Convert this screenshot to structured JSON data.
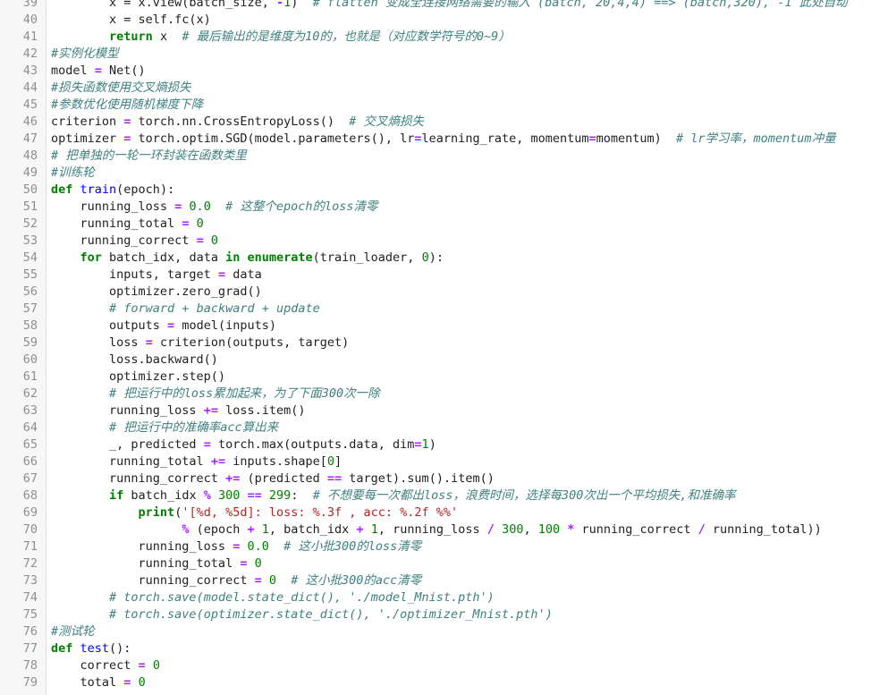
{
  "editor": {
    "language": "python",
    "colors": {
      "keyword": "#008000",
      "function_name": "#0000ff",
      "number": "#008000",
      "operator": "#aa22ff",
      "string": "#ba2121",
      "comment": "#408080",
      "line_number": "#8f8f8f",
      "text": "#1f1f1f"
    },
    "lines": [
      {
        "n": "39",
        "t": [
          [
            "tx",
            "        x = x.view(batch_size, "
          ],
          [
            "op",
            "-"
          ],
          [
            "num",
            "1"
          ],
          [
            "tx",
            ")  "
          ],
          [
            "cm",
            "# flatten 变成全连接网络需要的输入 (batch, 20,4,4) ==> (batch,320), -1 此处自动"
          ]
        ]
      },
      {
        "n": "40",
        "t": [
          [
            "tx",
            "        x = self.fc(x)"
          ]
        ]
      },
      {
        "n": "41",
        "t": [
          [
            "tx",
            "        "
          ],
          [
            "kw",
            "return"
          ],
          [
            "tx",
            " x  "
          ],
          [
            "cm",
            "# 最后输出的是维度为10的，也就是（对应数学符号的0~9）"
          ]
        ]
      },
      {
        "n": "42",
        "t": [
          [
            "cm",
            "#实例化模型"
          ]
        ]
      },
      {
        "n": "43",
        "t": [
          [
            "tx",
            "model "
          ],
          [
            "op",
            "="
          ],
          [
            "tx",
            " Net()"
          ]
        ]
      },
      {
        "n": "44",
        "t": [
          [
            "cm",
            "#损失函数使用交叉熵损失"
          ]
        ]
      },
      {
        "n": "45",
        "t": [
          [
            "cm",
            "#参数优化使用随机梯度下降"
          ]
        ]
      },
      {
        "n": "46",
        "t": [
          [
            "tx",
            "criterion "
          ],
          [
            "op",
            "="
          ],
          [
            "tx",
            " torch.nn.CrossEntropyLoss()  "
          ],
          [
            "cm",
            "# 交叉熵损失"
          ]
        ]
      },
      {
        "n": "47",
        "t": [
          [
            "tx",
            "optimizer "
          ],
          [
            "op",
            "="
          ],
          [
            "tx",
            " torch.optim.SGD(model.parameters(), lr"
          ],
          [
            "op",
            "="
          ],
          [
            "tx",
            "learning_rate, momentum"
          ],
          [
            "op",
            "="
          ],
          [
            "tx",
            "momentum)  "
          ],
          [
            "cm",
            "# lr学习率，momentum冲量"
          ]
        ]
      },
      {
        "n": "48",
        "t": [
          [
            "cm",
            "# 把单独的一轮一环封装在函数类里"
          ]
        ]
      },
      {
        "n": "49",
        "t": [
          [
            "cm",
            "#训练轮"
          ]
        ]
      },
      {
        "n": "50",
        "t": [
          [
            "kw",
            "def"
          ],
          [
            "tx",
            " "
          ],
          [
            "fn",
            "train"
          ],
          [
            "tx",
            "(epoch):"
          ]
        ]
      },
      {
        "n": "51",
        "t": [
          [
            "tx",
            "    running_loss "
          ],
          [
            "op",
            "="
          ],
          [
            "tx",
            " "
          ],
          [
            "num",
            "0.0"
          ],
          [
            "tx",
            "  "
          ],
          [
            "cm",
            "# 这整个epoch的loss清零"
          ]
        ]
      },
      {
        "n": "52",
        "t": [
          [
            "tx",
            "    running_total "
          ],
          [
            "op",
            "="
          ],
          [
            "tx",
            " "
          ],
          [
            "num",
            "0"
          ]
        ]
      },
      {
        "n": "53",
        "t": [
          [
            "tx",
            "    running_correct "
          ],
          [
            "op",
            "="
          ],
          [
            "tx",
            " "
          ],
          [
            "num",
            "0"
          ]
        ]
      },
      {
        "n": "54",
        "t": [
          [
            "tx",
            "    "
          ],
          [
            "kw",
            "for"
          ],
          [
            "tx",
            " batch_idx, data "
          ],
          [
            "kw",
            "in"
          ],
          [
            "tx",
            " "
          ],
          [
            "kw",
            "enumerate"
          ],
          [
            "tx",
            "(train_loader, "
          ],
          [
            "num",
            "0"
          ],
          [
            "tx",
            "):"
          ]
        ]
      },
      {
        "n": "55",
        "t": [
          [
            "tx",
            "        inputs, target "
          ],
          [
            "op",
            "="
          ],
          [
            "tx",
            " data"
          ]
        ]
      },
      {
        "n": "56",
        "t": [
          [
            "tx",
            "        optimizer.zero_grad()"
          ]
        ]
      },
      {
        "n": "57",
        "t": [
          [
            "tx",
            "        "
          ],
          [
            "cm",
            "# forward + backward + update"
          ]
        ]
      },
      {
        "n": "58",
        "t": [
          [
            "tx",
            "        outputs "
          ],
          [
            "op",
            "="
          ],
          [
            "tx",
            " model(inputs)"
          ]
        ]
      },
      {
        "n": "59",
        "t": [
          [
            "tx",
            "        loss "
          ],
          [
            "op",
            "="
          ],
          [
            "tx",
            " criterion(outputs, target)"
          ]
        ]
      },
      {
        "n": "60",
        "t": [
          [
            "tx",
            "        loss.backward()"
          ]
        ]
      },
      {
        "n": "61",
        "t": [
          [
            "tx",
            "        optimizer.step()"
          ]
        ]
      },
      {
        "n": "62",
        "t": [
          [
            "tx",
            "        "
          ],
          [
            "cm",
            "# 把运行中的loss累加起来，为了下面300次一除"
          ]
        ]
      },
      {
        "n": "63",
        "t": [
          [
            "tx",
            "        running_loss "
          ],
          [
            "op",
            "+="
          ],
          [
            "tx",
            " loss.item()"
          ]
        ]
      },
      {
        "n": "64",
        "t": [
          [
            "tx",
            "        "
          ],
          [
            "cm",
            "# 把运行中的准确率acc算出来"
          ]
        ]
      },
      {
        "n": "65",
        "t": [
          [
            "tx",
            "        _, predicted "
          ],
          [
            "op",
            "="
          ],
          [
            "tx",
            " torch.max(outputs.data, dim"
          ],
          [
            "op",
            "="
          ],
          [
            "num",
            "1"
          ],
          [
            "tx",
            ")"
          ]
        ]
      },
      {
        "n": "66",
        "t": [
          [
            "tx",
            "        running_total "
          ],
          [
            "op",
            "+="
          ],
          [
            "tx",
            " inputs.shape["
          ],
          [
            "num",
            "0"
          ],
          [
            "tx",
            "]"
          ]
        ]
      },
      {
        "n": "67",
        "t": [
          [
            "tx",
            "        running_correct "
          ],
          [
            "op",
            "+="
          ],
          [
            "tx",
            " (predicted "
          ],
          [
            "op",
            "=="
          ],
          [
            "tx",
            " target).sum().item()"
          ]
        ]
      },
      {
        "n": "68",
        "t": [
          [
            "tx",
            "        "
          ],
          [
            "kw",
            "if"
          ],
          [
            "tx",
            " batch_idx "
          ],
          [
            "op",
            "%"
          ],
          [
            "tx",
            " "
          ],
          [
            "num",
            "300"
          ],
          [
            "tx",
            " "
          ],
          [
            "op",
            "=="
          ],
          [
            "tx",
            " "
          ],
          [
            "num",
            "299"
          ],
          [
            "tx",
            ":  "
          ],
          [
            "cm",
            "# 不想要每一次都出loss，浪费时间，选择每300次出一个平均损失,和准确率"
          ]
        ]
      },
      {
        "n": "69",
        "t": [
          [
            "tx",
            "            "
          ],
          [
            "kw",
            "print"
          ],
          [
            "tx",
            "("
          ],
          [
            "str",
            "'[%d, %5d]: loss: %.3f , acc: %.2f %%'"
          ]
        ]
      },
      {
        "n": "70",
        "t": [
          [
            "tx",
            "                  "
          ],
          [
            "op",
            "%"
          ],
          [
            "tx",
            " (epoch "
          ],
          [
            "op",
            "+"
          ],
          [
            "tx",
            " "
          ],
          [
            "num",
            "1"
          ],
          [
            "tx",
            ", batch_idx "
          ],
          [
            "op",
            "+"
          ],
          [
            "tx",
            " "
          ],
          [
            "num",
            "1"
          ],
          [
            "tx",
            ", running_loss "
          ],
          [
            "op",
            "/"
          ],
          [
            "tx",
            " "
          ],
          [
            "num",
            "300"
          ],
          [
            "tx",
            ", "
          ],
          [
            "num",
            "100"
          ],
          [
            "tx",
            " "
          ],
          [
            "op",
            "*"
          ],
          [
            "tx",
            " running_correct "
          ],
          [
            "op",
            "/"
          ],
          [
            "tx",
            " running_total))"
          ]
        ]
      },
      {
        "n": "71",
        "t": [
          [
            "tx",
            "            running_loss "
          ],
          [
            "op",
            "="
          ],
          [
            "tx",
            " "
          ],
          [
            "num",
            "0.0"
          ],
          [
            "tx",
            "  "
          ],
          [
            "cm",
            "# 这小批300的loss清零"
          ]
        ]
      },
      {
        "n": "72",
        "t": [
          [
            "tx",
            "            running_total "
          ],
          [
            "op",
            "="
          ],
          [
            "tx",
            " "
          ],
          [
            "num",
            "0"
          ]
        ]
      },
      {
        "n": "73",
        "t": [
          [
            "tx",
            "            running_correct "
          ],
          [
            "op",
            "="
          ],
          [
            "tx",
            " "
          ],
          [
            "num",
            "0"
          ],
          [
            "tx",
            "  "
          ],
          [
            "cm",
            "# 这小批300的acc清零"
          ]
        ]
      },
      {
        "n": "74",
        "t": [
          [
            "tx",
            "        "
          ],
          [
            "cm",
            "# torch.save(model.state_dict(), './model_Mnist.pth')"
          ]
        ]
      },
      {
        "n": "75",
        "t": [
          [
            "tx",
            "        "
          ],
          [
            "cm",
            "# torch.save(optimizer.state_dict(), './optimizer_Mnist.pth')"
          ]
        ]
      },
      {
        "n": "76",
        "t": [
          [
            "cm",
            "#测试轮"
          ]
        ]
      },
      {
        "n": "77",
        "t": [
          [
            "kw",
            "def"
          ],
          [
            "tx",
            " "
          ],
          [
            "fn",
            "test"
          ],
          [
            "tx",
            "():"
          ]
        ]
      },
      {
        "n": "78",
        "t": [
          [
            "tx",
            "    correct "
          ],
          [
            "op",
            "="
          ],
          [
            "tx",
            " "
          ],
          [
            "num",
            "0"
          ]
        ]
      },
      {
        "n": "79",
        "t": [
          [
            "tx",
            "    total "
          ],
          [
            "op",
            "="
          ],
          [
            "tx",
            " "
          ],
          [
            "num",
            "0"
          ]
        ]
      }
    ]
  }
}
